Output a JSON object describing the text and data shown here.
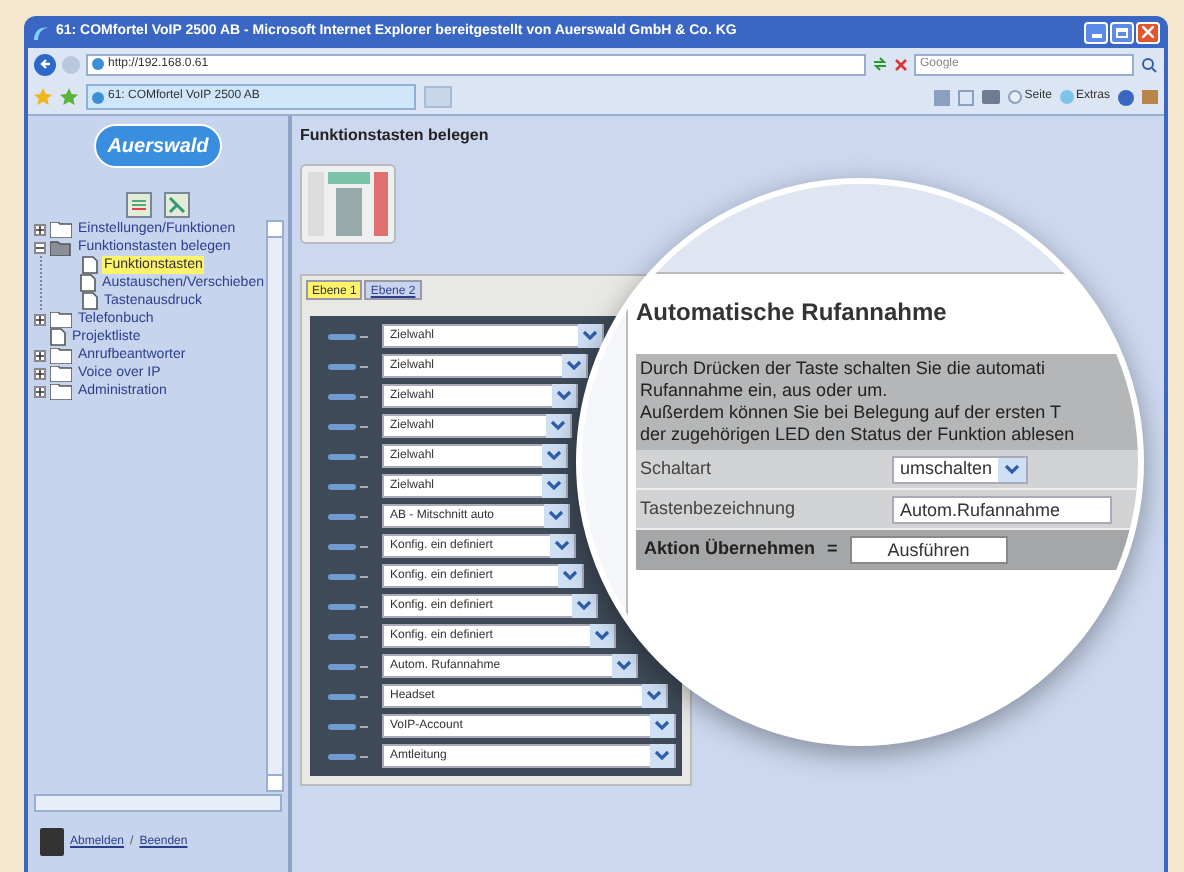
{
  "window": {
    "title": "61: COMfortel VoIP 2500 AB - Microsoft Internet Explorer bereitgestellt von Auerswald GmbH & Co. KG"
  },
  "address_bar": {
    "value": "http://192.168.0.61",
    "search_placeholder": "Google"
  },
  "browser_tab": {
    "title": "61: COMfortel VoIP 2500 AB"
  },
  "toolbar": [
    "Seite",
    "Extras"
  ],
  "sidebar": {
    "logo": "Auerswald",
    "tree": [
      {
        "label": "Einstellungen/Funktionen",
        "kind": "folder",
        "expanded": false
      },
      {
        "label": "Funktionstasten belegen",
        "kind": "folder",
        "expanded": true,
        "children": [
          {
            "label": "Funktionstasten",
            "kind": "page",
            "selected": true
          },
          {
            "label": "Austauschen/Verschieben",
            "kind": "page",
            "selected": false
          },
          {
            "label": "Tastenausdruck",
            "kind": "page",
            "selected": false
          }
        ]
      },
      {
        "label": "Telefonbuch",
        "kind": "folder",
        "expanded": false
      },
      {
        "label": "Projektliste",
        "kind": "page",
        "selected": false
      },
      {
        "label": "Anrufbeantworter",
        "kind": "folder",
        "expanded": false
      },
      {
        "label": "Voice over IP",
        "kind": "folder",
        "expanded": false
      },
      {
        "label": "Administration",
        "kind": "folder",
        "expanded": false
      }
    ],
    "footer": {
      "links": [
        "Abmelden",
        "Beenden"
      ],
      "separator": "/"
    }
  },
  "page": {
    "title": "Funktionstasten belegen",
    "tabs": [
      {
        "label": "Ebene 1",
        "selected": true
      },
      {
        "label": "Ebene 2",
        "selected": false
      }
    ],
    "keys": [
      "Zielwahl",
      "Zielwahl",
      "Zielwahl",
      "Zielwahl",
      "Zielwahl",
      "Zielwahl",
      "AB - Mitschnitt auto",
      "Konfig. ein definiert",
      "Konfig. ein definiert",
      "Konfig. ein definiert",
      "Konfig. ein definiert",
      "Autom. Rufannahme",
      "Headset",
      "VoIP-Account",
      "Amtleitung"
    ]
  },
  "magnifier": {
    "title": "Automatische Rufannahme",
    "description": [
      "Durch Drücken der Taste schalten Sie die automati",
      "Rufannahme ein, aus oder um.",
      "Außerdem können Sie bei Belegung auf der ersten T",
      "der zugehörigen LED den Status der Funktion ablesen"
    ],
    "fields": [
      {
        "label": "Schaltart",
        "kind": "select",
        "value": "umschalten"
      },
      {
        "label": "Tastenbezeichnung",
        "kind": "text",
        "value": "Autom.Rufannahme"
      }
    ],
    "action": {
      "label": "Aktion Übernehmen",
      "separator": "=",
      "button": "Ausführen"
    }
  }
}
